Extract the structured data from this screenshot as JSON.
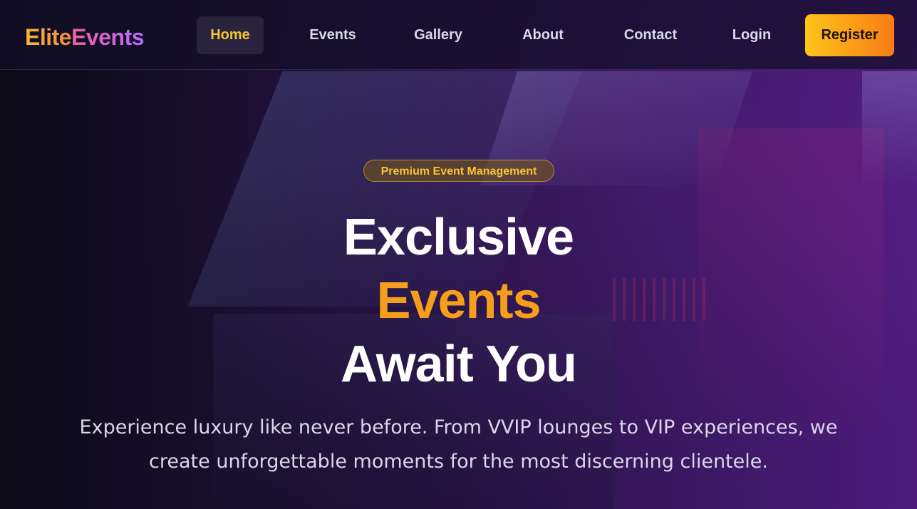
{
  "brand": {
    "part_1": "Elite",
    "part_2": "Events"
  },
  "nav": {
    "items": [
      {
        "label": "Home",
        "active": true
      },
      {
        "label": "Events",
        "active": false
      },
      {
        "label": "Gallery",
        "active": false
      },
      {
        "label": "About",
        "active": false
      },
      {
        "label": "Contact",
        "active": false
      }
    ],
    "login_label": "Login",
    "register_label": "Register"
  },
  "hero": {
    "badge": "Premium Event Management",
    "headline_line_1": "Exclusive",
    "headline_line_2": "Events",
    "headline_line_3": "Await You",
    "subtitle": "Experience luxury like never before. From VVIP lounges to VIP experiences, we create unforgettable moments for the most discerning clientele."
  },
  "colors": {
    "accent_gold": "#f7c531",
    "accent_orange": "#f59e1b",
    "register_gradient_start": "#fcc419",
    "register_gradient_end": "#f97c16",
    "background_dark": "#120d24",
    "background_purple": "#581e8c"
  }
}
